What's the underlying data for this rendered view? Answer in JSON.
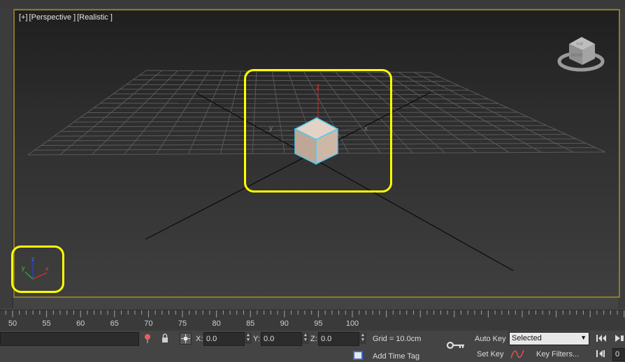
{
  "viewport": {
    "label_parts": [
      "[+]",
      "[Perspective ]",
      "[Realistic ]"
    ],
    "axis_labels": {
      "z": "z",
      "y": "y",
      "x": "x"
    },
    "viewcube": {
      "front": "FRONT",
      "top": "TOP"
    },
    "tripod": {
      "z": "z",
      "y": "y",
      "x": "x"
    }
  },
  "timeline": {
    "labels": [
      "50",
      "55",
      "60",
      "65",
      "70",
      "75",
      "80",
      "85",
      "90",
      "95",
      "100"
    ]
  },
  "status": {
    "x_label": "X:",
    "x_value": "0.0",
    "y_label": "Y:",
    "y_value": "0.0",
    "z_label": "Z:",
    "z_value": "0.0",
    "grid": "Grid = 10.0cm",
    "add_time_tag": "Add Time Tag",
    "auto_key": "Auto Key",
    "set_key": "Set Key",
    "selected": "Selected",
    "key_filters": "Key Filters...",
    "frame_value": "0"
  },
  "colors": {
    "highlight": "#ffff00",
    "viewport_border": "#8c7a2a",
    "box_face": "#c8b4a4",
    "selection_outline": "#4ec8f0"
  }
}
